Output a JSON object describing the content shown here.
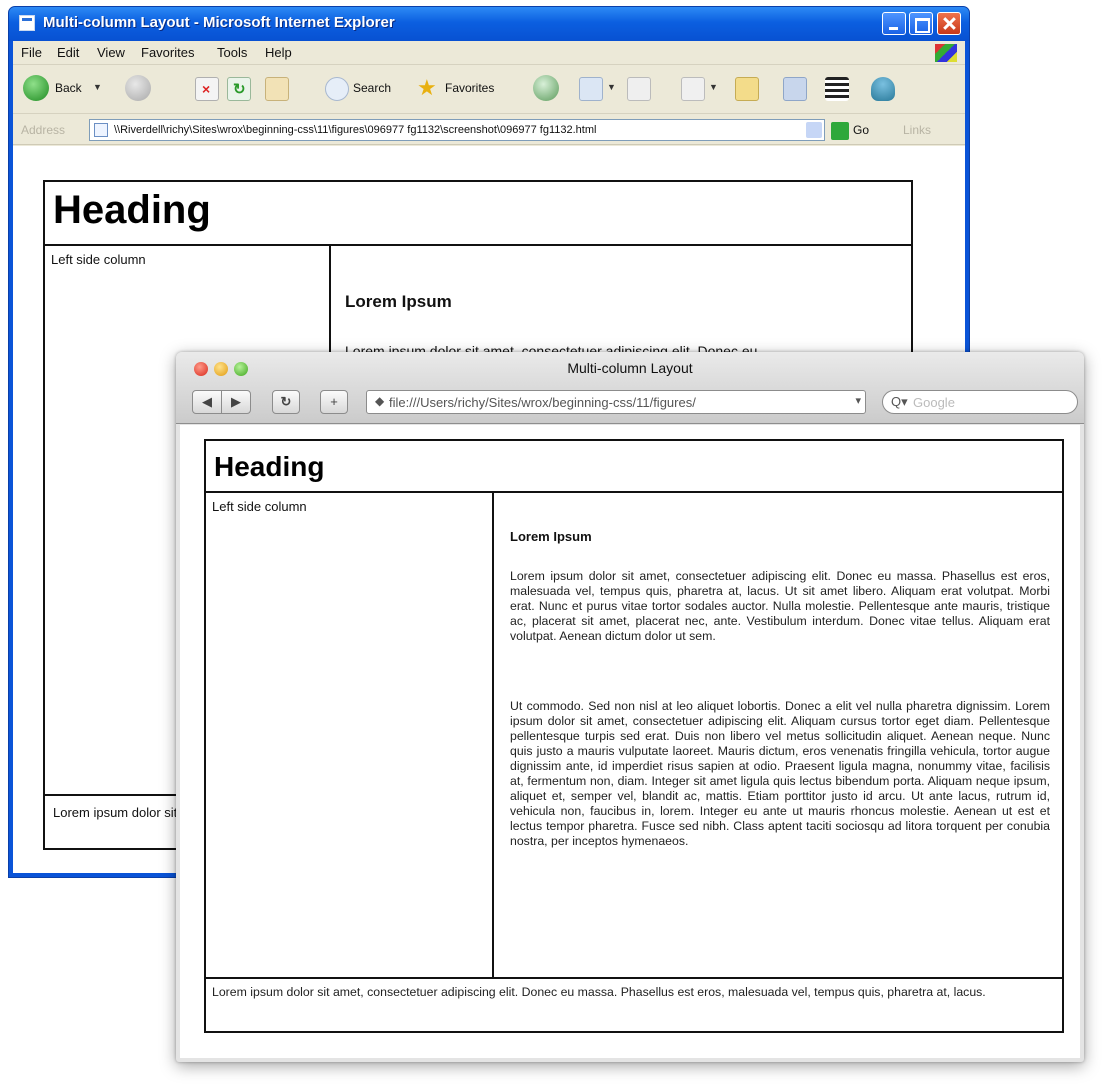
{
  "ie": {
    "title": "Multi-column Layout - Microsoft Internet Explorer",
    "menu": [
      "File",
      "Edit",
      "View",
      "Favorites",
      "Tools",
      "Help"
    ],
    "toolbar": {
      "back": "Back",
      "search": "Search",
      "favorites": "Favorites"
    },
    "address_label": "Address",
    "address": "\\\\Riverdell\\richy\\Sites\\wrox\\beginning-css\\11\\figures\\096977 fg1132\\screenshot\\096977 fg1132.html",
    "go": "Go",
    "links": "Links",
    "page": {
      "heading": "Heading",
      "left_label": "Left side column",
      "main_title": "Lorem Ipsum",
      "para": "Lorem ipsum dolor sit amet, consectetuer adipiscing elit. Donec eu",
      "footer": "Lorem ipsum dolor sit amet, consectetuer adipiscing elit. Donec eu massa. Phasellus est eros, malesuada vel, tempus quis, pharetra at, lacus."
    }
  },
  "safari": {
    "title": "Multi-column Layout",
    "url": "file:///Users/richy/Sites/wrox/beginning-css/11/figures/",
    "search_placeholder": "Google",
    "page": {
      "heading": "Heading",
      "left_label": "Left side column",
      "main_title": "Lorem Ipsum",
      "para1": "Lorem ipsum dolor sit amet, consectetuer adipiscing elit. Donec eu massa. Phasellus est eros, malesuada vel, tempus quis, pharetra at, lacus. Ut sit amet libero. Aliquam erat volutpat. Morbi erat. Nunc et purus vitae tortor sodales auctor. Nulla molestie. Pellentesque ante mauris, tristique ac, placerat sit amet, placerat nec, ante. Vestibulum interdum. Donec vitae tellus. Aliquam erat volutpat. Aenean dictum dolor ut sem.",
      "para2": "Ut commodo. Sed non nisl at leo aliquet lobortis. Donec a elit vel nulla pharetra dignissim. Lorem ipsum dolor sit amet, consectetuer adipiscing elit. Aliquam cursus tortor eget diam. Pellentesque pellentesque turpis sed erat. Duis non libero vel metus sollicitudin aliquet. Aenean neque. Nunc quis justo a mauris vulputate laoreet. Mauris dictum, eros venenatis fringilla vehicula, tortor augue dignissim ante, id imperdiet risus sapien at odio. Praesent ligula magna, nonummy vitae, facilisis at, fermentum non, diam. Integer sit amet ligula quis lectus bibendum porta. Aliquam neque ipsum, aliquet et, semper vel, blandit ac, mattis. Etiam porttitor justo id arcu. Ut ante lacus, rutrum id, vehicula non, faucibus in, lorem. Integer eu ante ut mauris rhoncus molestie. Aenean ut est et lectus tempor pharetra. Fusce sed nibh. Class aptent taciti sociosqu ad litora torquent per conubia nostra, per inceptos hymenaeos.",
      "footer": "Lorem ipsum dolor sit amet, consectetuer adipiscing elit. Donec eu massa. Phasellus est eros, malesuada vel, tempus quis, pharetra at, lacus."
    }
  }
}
